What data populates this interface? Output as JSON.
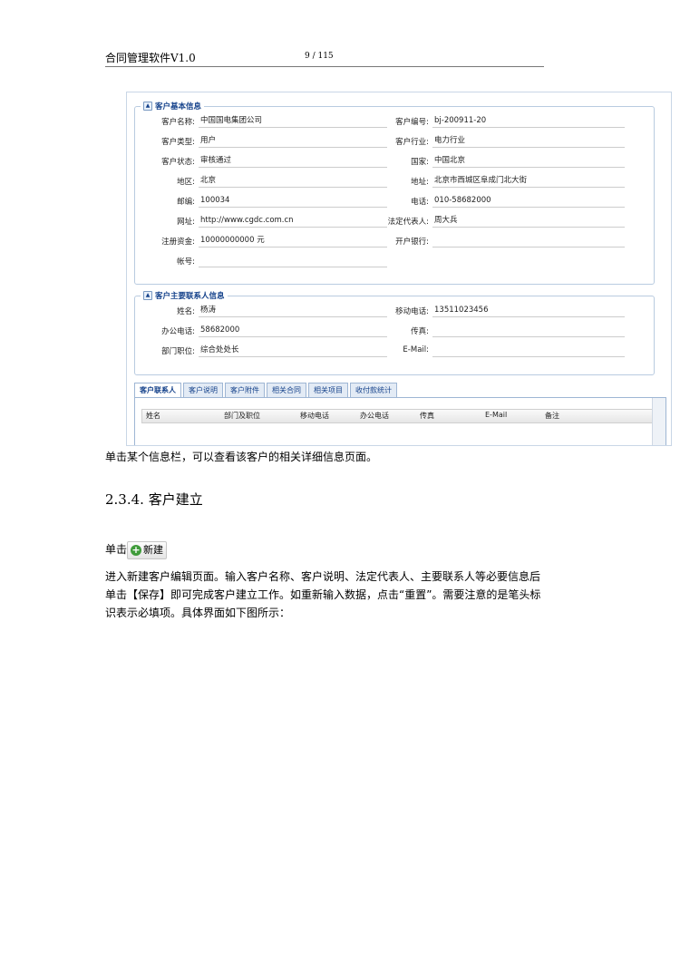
{
  "header": {
    "title": "合同管理软件V1.0",
    "page": "9 / 115"
  },
  "screenshot": {
    "basic": {
      "title": "客户基本信息",
      "rows": [
        {
          "l1": "客户名称:",
          "v1": "中国国电集团公司",
          "l2": "客户编号:",
          "v2": "bj-200911-20"
        },
        {
          "l1": "客户类型:",
          "v1": "用户",
          "l2": "客户行业:",
          "v2": "电力行业"
        },
        {
          "l1": "客户状态:",
          "v1": "审核通过",
          "l2": "国家:",
          "v2": "中国北京"
        },
        {
          "l1": "地区:",
          "v1": "北京",
          "l2": "地址:",
          "v2": "北京市西城区阜成门北大街"
        },
        {
          "l1": "邮编:",
          "v1": "100034",
          "l2": "电话:",
          "v2": "010-58682000"
        },
        {
          "l1": "网址:",
          "v1": "http://www.cgdc.com.cn",
          "l2": "法定代表人:",
          "v2": "周大兵"
        },
        {
          "l1": "注册资金:",
          "v1": "10000000000 元",
          "l2": "开户银行:",
          "v2": ""
        },
        {
          "l1": "帐号:",
          "v1": "",
          "l2": "",
          "v2": ""
        }
      ]
    },
    "contact": {
      "title": "客户主要联系人信息",
      "rows": [
        {
          "l1": "姓名:",
          "v1": "杨涛",
          "l2": "移动电话:",
          "v2": "13511023456"
        },
        {
          "l1": "办公电话:",
          "v1": "58682000",
          "l2": "传真:",
          "v2": ""
        },
        {
          "l1": "部门职位:",
          "v1": "综合处处长",
          "l2": "E-Mail:",
          "v2": ""
        }
      ]
    },
    "tabs": [
      "客户联系人",
      "客户说明",
      "客户附件",
      "相关合同",
      "相关项目",
      "收付款统计"
    ],
    "grid_columns": [
      "姓名",
      "部门及职位",
      "移动电话",
      "办公电话",
      "传真",
      "E-Mail",
      "备注"
    ]
  },
  "body": {
    "p1": "单击某个信息栏，可以查看该客户的相关详细信息页面。",
    "heading": "2.3.4. 客户建立",
    "p2_prefix": "单击",
    "new_button": "新建",
    "p3_line1": "进入新建客户编辑页面。输入客户名称、客户说明、法定代表人、主要联系人等必要信息后",
    "p3_line2": "单击【保存】即可完成客户建立工作。如重新输入数据，点击“重置”。需要注意的是笔头标",
    "p3_line3": "识表示必填项。具体界面如下图所示："
  }
}
